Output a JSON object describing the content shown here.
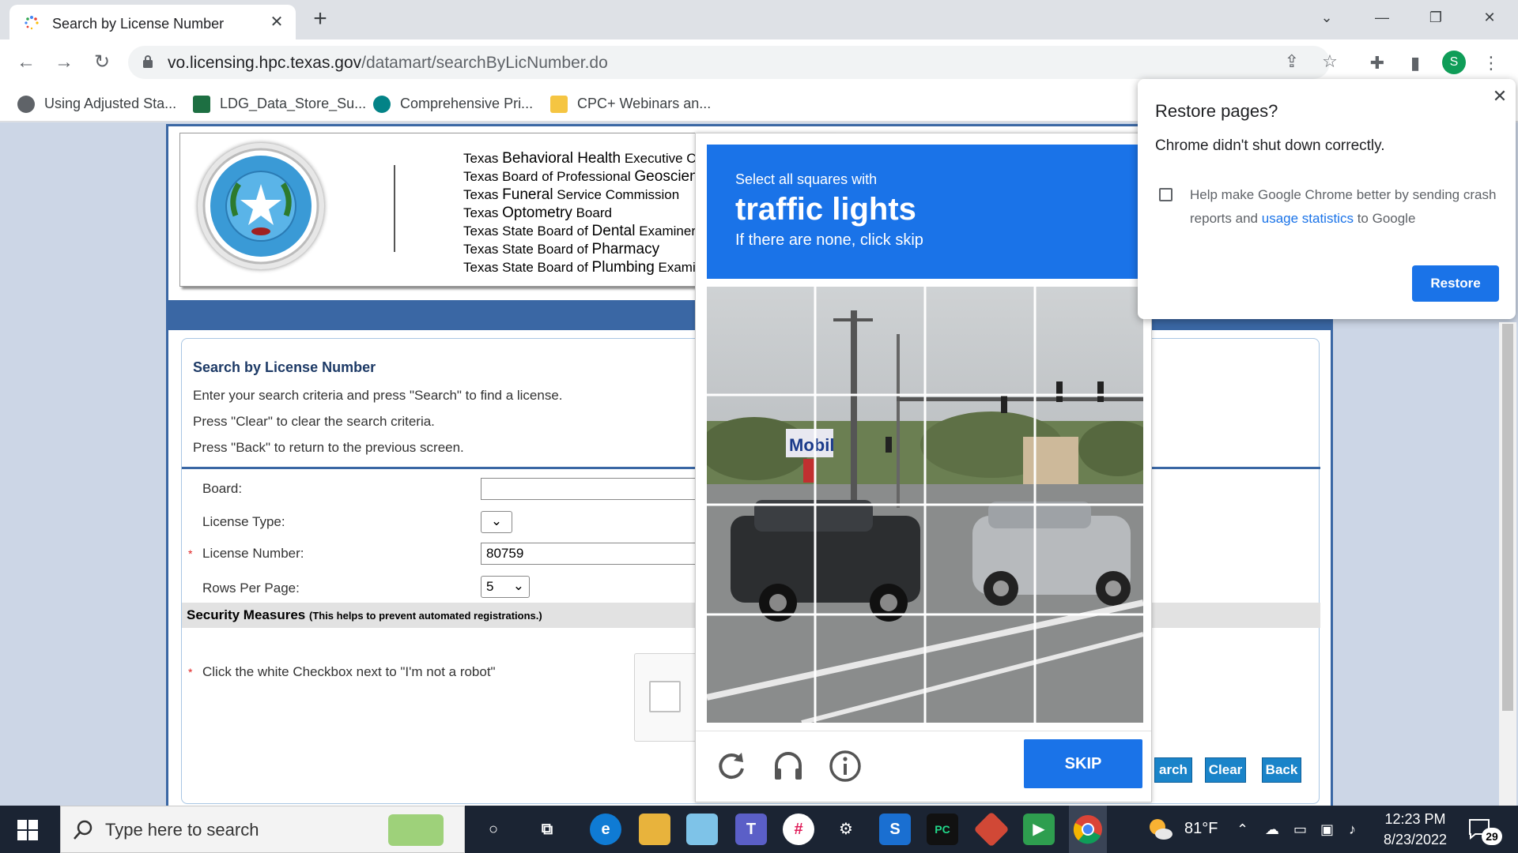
{
  "browser": {
    "tab_title": "Search by License Number",
    "tab_close": "✕",
    "new_tab": "+",
    "url_host": "vo.licensing.hpc.texas.gov",
    "url_path": "/datamart/searchByLicNumber.do",
    "profile_initial": "S",
    "bookmarks": [
      {
        "label": "Using Adjusted Sta...",
        "icon": "globe-icon",
        "color": "#5f6368"
      },
      {
        "label": "LDG_Data_Store_Su...",
        "icon": "excel-icon",
        "color": "#1d6f42"
      },
      {
        "label": "Comprehensive Pri...",
        "icon": "sharepoint-icon",
        "color": "#038387"
      },
      {
        "label": "CPC+ Webinars an...",
        "icon": "folder-icon",
        "color": "#f5c542"
      }
    ]
  },
  "header": {
    "boards": [
      {
        "pre": "Texas ",
        "key": "Behavioral Health",
        "post": " Executive Co"
      },
      {
        "pre": "Texas Board of Professional ",
        "key": "Geoscient",
        "post": ""
      },
      {
        "pre": "Texas ",
        "key": "Funeral",
        "post": " Service Commission"
      },
      {
        "pre": "Texas ",
        "key": "Optometry",
        "post": " Board"
      },
      {
        "pre": "Texas State Board of ",
        "key": "Dental",
        "post": " Examiners"
      },
      {
        "pre": "Texas State Board of ",
        "key": "Pharmacy",
        "post": ""
      },
      {
        "pre": "Texas State Board of ",
        "key": "Plumbing",
        "post": " Examir"
      }
    ]
  },
  "search": {
    "title": "Search by License Number",
    "line1": "Enter your search criteria and press \"Search\" to find a license.",
    "line2": "Press \"Clear\" to clear the search criteria.",
    "line3": "Press \"Back\" to return to the previous screen.",
    "board_label": "Board:",
    "board_value": "",
    "license_type_label": "License Type:",
    "license_type_value": "",
    "license_number_label": "License Number:",
    "license_number_value": "80759",
    "rows_label": "Rows Per Page:",
    "rows_value": "5",
    "required_mark": "*",
    "security_title": "Security Measures",
    "security_note": "(This helps to prevent automated registrations.)",
    "robot_instruction": "Click the white Checkbox next to \"I'm not a robot\"",
    "btn_search": "arch",
    "btn_clear": "Clear",
    "btn_back": "Back"
  },
  "captcha": {
    "line1": "Select all squares with",
    "line2": "traffic lights",
    "line3": "If there are none, click skip",
    "skip": "SKIP"
  },
  "restore": {
    "title": "Restore pages?",
    "subtitle": "Chrome didn't shut down correctly.",
    "text_before": "Help make Google Chrome better by sending crash reports and ",
    "link": "usage statistics",
    "text_after": " to Google",
    "button": "Restore",
    "close": "✕"
  },
  "taskbar": {
    "search_placeholder": "Type here to search",
    "temperature": "81°F",
    "time": "12:23 PM",
    "date": "8/23/2022",
    "notification_count": "29"
  },
  "colors": {
    "brand_blue": "#3a67a4",
    "captcha_blue": "#1a73e8",
    "button_blue": "#1a84c9"
  }
}
